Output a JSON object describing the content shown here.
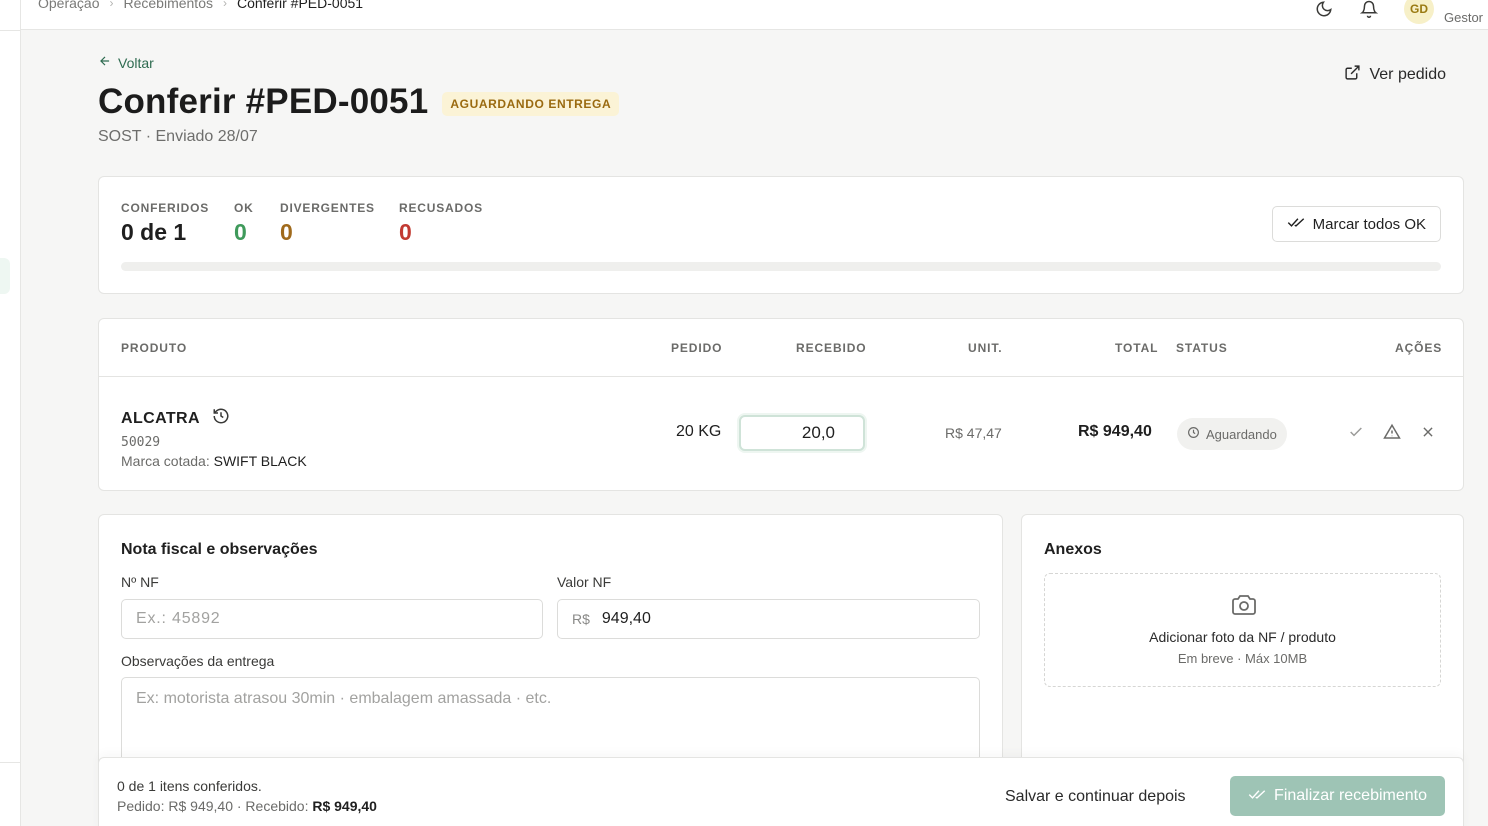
{
  "breadcrumb": [
    "Operação",
    "Recebimentos",
    "Conferir #PED-0051"
  ],
  "header": {
    "avatar": "GD",
    "role": "Gestor"
  },
  "back_label": "Voltar",
  "title": "Conferir #PED-0051",
  "status_badge": "AGUARDANDO ENTREGA",
  "subtitle": "SOST · Enviado 28/07",
  "view_order_label": "Ver pedido",
  "summary": {
    "conferidos_label": "CONFERIDOS",
    "conferidos_value": "0 de 1",
    "ok_label": "OK",
    "ok_value": "0",
    "divergentes_label": "DIVERGENTES",
    "divergentes_value": "0",
    "recusados_label": "RECUSADOS",
    "recusados_value": "0",
    "progress": 0,
    "mark_all_label": "Marcar todos OK"
  },
  "table": {
    "headers": {
      "produto": "PRODUTO",
      "pedido": "PEDIDO",
      "recebido": "RECEBIDO",
      "unit": "UNIT.",
      "total": "TOTAL",
      "status": "STATUS",
      "acoes": "AÇÕES"
    },
    "rows": [
      {
        "name": "ALCATRA",
        "code": "50029",
        "brand_label": "Marca cotada:",
        "brand": "SWIFT BLACK",
        "pedido": "20 KG",
        "recebido": "20,0",
        "unit": "R$ 47,47",
        "total": "R$ 949,40",
        "status": "Aguardando"
      }
    ]
  },
  "nf": {
    "title": "Nota fiscal e observações",
    "numero_label": "Nº NF",
    "numero_placeholder": "Ex.: 45892",
    "valor_label": "Valor NF",
    "valor_prefix": "R$",
    "valor": "949,40",
    "obs_label": "Observações da entrega",
    "obs_placeholder": "Ex: motorista atrasou 30min · embalagem amassada · etc."
  },
  "anexos": {
    "title": "Anexos",
    "main": "Adicionar foto da NF / produto",
    "sub": "Em breve · Máx 10MB"
  },
  "footer": {
    "count": "0 de 1 itens conferidos.",
    "totals_prefix": "Pedido: R$ 949,40 · Recebido:",
    "totals_received": "R$ 949,40",
    "save_later": "Salvar e continuar depois",
    "finalize": "Finalizar recebimento"
  },
  "colors": {
    "accent": "#3f8f63",
    "ok": "#3f9a5b",
    "divergent": "#a06a1c",
    "refused": "#c23a32",
    "finalize_bg": "#9ec4b5"
  }
}
